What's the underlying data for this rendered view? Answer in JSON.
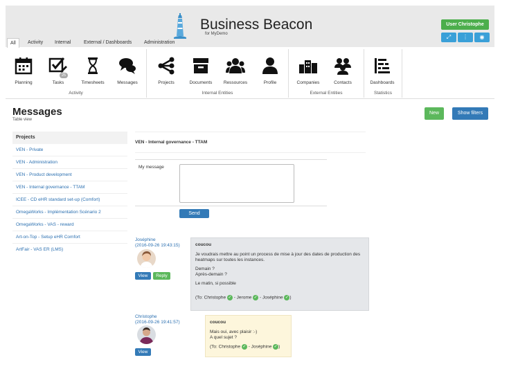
{
  "app": {
    "title": "Business Beacon",
    "subtitle": "for MyDemo"
  },
  "user": {
    "button_label": "User Christophe"
  },
  "header_icons": [
    "expand-icon",
    "info-icon",
    "eye-icon"
  ],
  "tabs": [
    {
      "label": "All",
      "active": true
    },
    {
      "label": "Activity"
    },
    {
      "label": "Internal"
    },
    {
      "label": "External / Dashboards"
    },
    {
      "label": "Administration"
    }
  ],
  "ribbon": {
    "items": [
      {
        "label": "Planning",
        "icon": "calendar-icon"
      },
      {
        "label": "Tasks",
        "icon": "tasks-icon",
        "badge": "25"
      },
      {
        "label": "Timesheets",
        "icon": "hourglass-icon"
      },
      {
        "label": "Messages",
        "icon": "chat-icon"
      },
      {
        "label": "Projects",
        "icon": "share-icon"
      },
      {
        "label": "Documents",
        "icon": "archive-icon"
      },
      {
        "label": "Ressources",
        "icon": "users-icon"
      },
      {
        "label": "Profile",
        "icon": "user-icon"
      },
      {
        "label": "Companies",
        "icon": "buildings-icon"
      },
      {
        "label": "Contacts",
        "icon": "contacts-icon"
      },
      {
        "label": "Dashboards",
        "icon": "bar-chart-icon"
      }
    ],
    "groups": [
      "Activity",
      "Internal Entities",
      "External Entities",
      "Statistics"
    ]
  },
  "page": {
    "title": "Messages",
    "subtitle": "Table view",
    "new_label": "New",
    "filters_label": "Show filters"
  },
  "projects": {
    "header": "Projects",
    "items": [
      "VEN - Private",
      "VEN - Administration",
      "VEN - Product development",
      "VEN - Internal governance - TTAM",
      "ICEE - CD eHR standard set-up (Comfort)",
      "OmegaWorks - Implémentation Scénario 2",
      "OmegaWorks - VAS - reward",
      "Art-on-Top - Setup eHR Comfort",
      "ArtFair - VAS ER (LMS)"
    ]
  },
  "conversation": {
    "title": "VEN - Internal governance - TTAM",
    "my_message_label": "My message",
    "send_label": "Send"
  },
  "messages": [
    {
      "author": "Joséphine",
      "date": "(2016-09-26 19:43:15)",
      "view_label": "View",
      "reply_label": "Reply",
      "subject": "coucou",
      "body1": "Je voudrais mettre au point un process de mise à jour des dates de production des heatmaps sur toutes les instances.",
      "body2a": "Demain ?",
      "body2b": "Après-demain ?",
      "body3": "Le matin, si possible",
      "to_prefix": "(To: Christophe",
      "to_2": "- Jerome",
      "to_3": "- Joséphine",
      "to_suffix": ")"
    },
    {
      "author": "Christophe",
      "date": "(2016-09-26 19:41:57)",
      "view_label": "View",
      "subject": "coucou",
      "body1": "Mais oui, avec plaisir :-)",
      "body2": "A quel sujet ?",
      "to_prefix": "(To: Christophe",
      "to_2": "- Joséphine",
      "to_suffix": ")"
    }
  ],
  "colors": {
    "blue": "#337ab7",
    "green": "#5cb85c",
    "teal": "#3aa0d8",
    "link": "#2a6fb0"
  }
}
